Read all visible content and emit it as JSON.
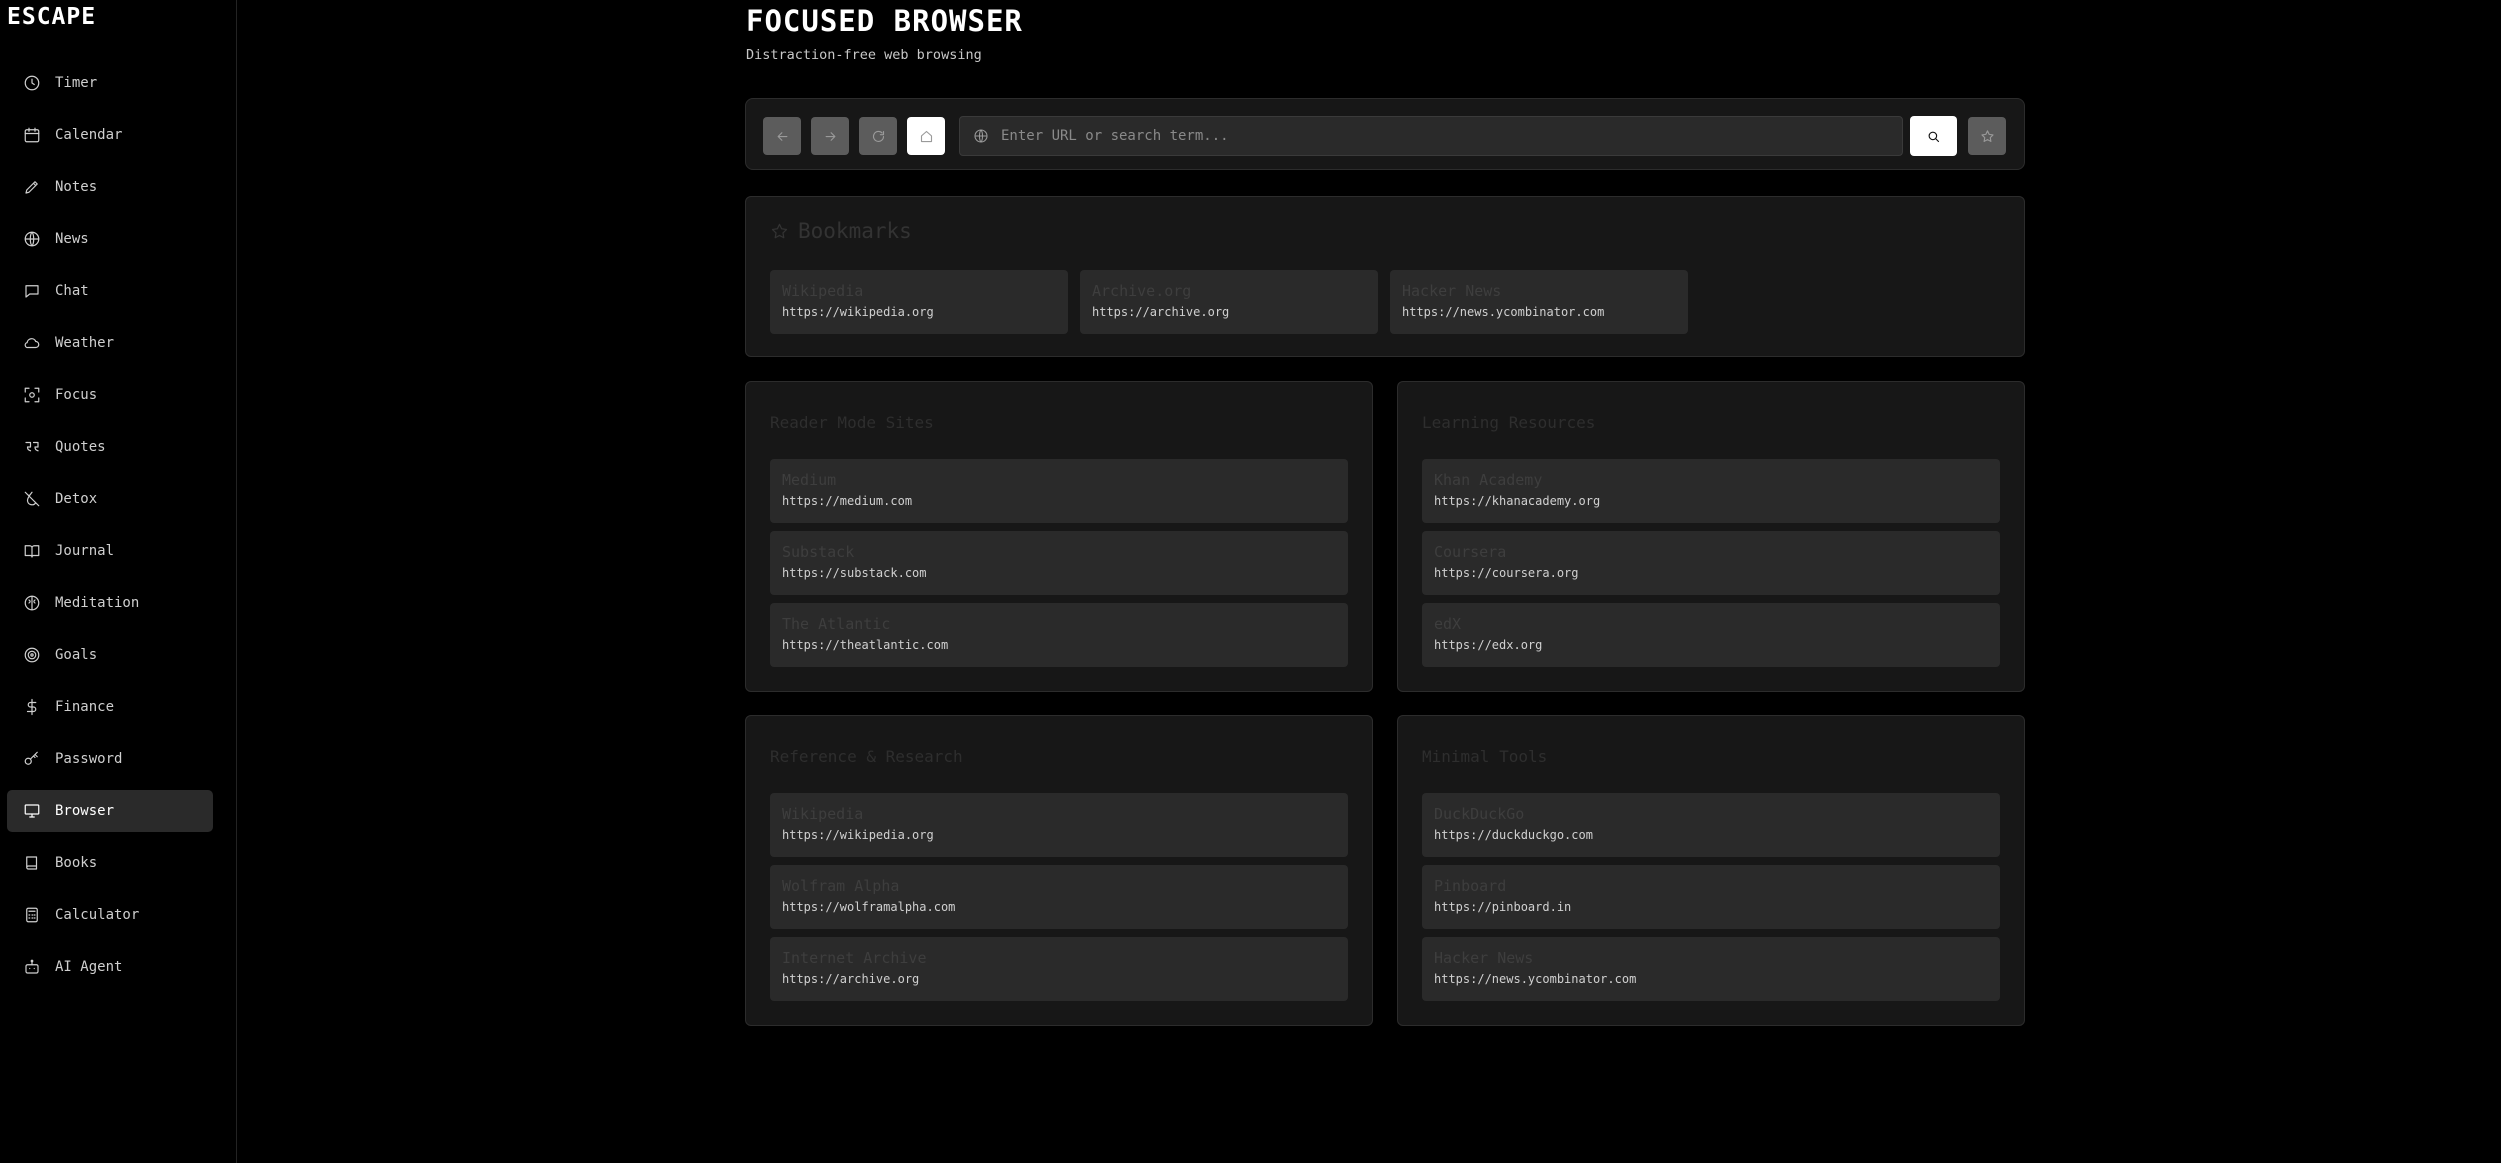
{
  "app": {
    "brand": "ESCAPE"
  },
  "sidebar": {
    "items": [
      {
        "label": "Timer",
        "icon": "clock-icon"
      },
      {
        "label": "Calendar",
        "icon": "calendar-icon"
      },
      {
        "label": "Notes",
        "icon": "pencil-icon"
      },
      {
        "label": "News",
        "icon": "globe-icon"
      },
      {
        "label": "Chat",
        "icon": "chat-bubble-icon"
      },
      {
        "label": "Weather",
        "icon": "cloud-icon"
      },
      {
        "label": "Focus",
        "icon": "focus-icon"
      },
      {
        "label": "Quotes",
        "icon": "quote-icon"
      },
      {
        "label": "Detox",
        "icon": "drop-off-icon"
      },
      {
        "label": "Journal",
        "icon": "book-open-icon"
      },
      {
        "label": "Meditation",
        "icon": "brain-icon"
      },
      {
        "label": "Goals",
        "icon": "target-icon"
      },
      {
        "label": "Finance",
        "icon": "dollar-icon"
      },
      {
        "label": "Password",
        "icon": "key-icon"
      },
      {
        "label": "Browser",
        "icon": "monitor-icon",
        "active": true
      },
      {
        "label": "Books",
        "icon": "book-icon"
      },
      {
        "label": "Calculator",
        "icon": "calculator-icon"
      },
      {
        "label": "AI Agent",
        "icon": "bot-icon"
      }
    ]
  },
  "header": {
    "title": "FOCUSED BROWSER",
    "subtitle": "Distraction-free web browsing"
  },
  "toolbar": {
    "url_placeholder": "Enter URL or search term...",
    "url_value": ""
  },
  "bookmarks": {
    "title": "Bookmarks",
    "items": [
      {
        "name": "Wikipedia",
        "url": "https://wikipedia.org"
      },
      {
        "name": "Archive.org",
        "url": "https://archive.org"
      },
      {
        "name": "Hacker News",
        "url": "https://news.ycombinator.com"
      }
    ]
  },
  "sections": [
    {
      "title": "Reader Mode Sites",
      "items": [
        {
          "name": "Medium",
          "url": "https://medium.com"
        },
        {
          "name": "Substack",
          "url": "https://substack.com"
        },
        {
          "name": "The Atlantic",
          "url": "https://theatlantic.com"
        }
      ]
    },
    {
      "title": "Learning Resources",
      "items": [
        {
          "name": "Khan Academy",
          "url": "https://khanacademy.org"
        },
        {
          "name": "Coursera",
          "url": "https://coursera.org"
        },
        {
          "name": "edX",
          "url": "https://edx.org"
        }
      ]
    },
    {
      "title": "Reference & Research",
      "items": [
        {
          "name": "Wikipedia",
          "url": "https://wikipedia.org"
        },
        {
          "name": "Wolfram Alpha",
          "url": "https://wolframalpha.com"
        },
        {
          "name": "Internet Archive",
          "url": "https://archive.org"
        }
      ]
    },
    {
      "title": "Minimal Tools",
      "items": [
        {
          "name": "DuckDuckGo",
          "url": "https://duckduckgo.com"
        },
        {
          "name": "Pinboard",
          "url": "https://pinboard.in"
        },
        {
          "name": "Hacker News",
          "url": "https://news.ycombinator.com"
        }
      ]
    }
  ]
}
